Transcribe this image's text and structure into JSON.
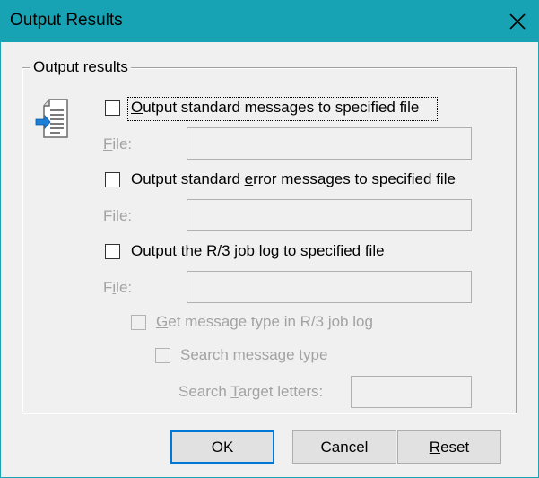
{
  "window": {
    "title": "Output Results",
    "close_icon": "close-icon"
  },
  "group": {
    "legend": "Output results",
    "icon": "document-output-icon"
  },
  "options": {
    "standard_messages": {
      "label_prefix": "",
      "label_mnemonic": "O",
      "label_rest": "utput standard messages to specified file",
      "checked": false,
      "file_label_mnemonic": "F",
      "file_label_rest": "ile:",
      "file_value": ""
    },
    "standard_error": {
      "label_prefix": "Output standard ",
      "label_mnemonic": "e",
      "label_rest": "rror messages to specified file",
      "checked": false,
      "file_label_prefix": "Fil",
      "file_label_mnemonic": "e",
      "file_label_rest": ":",
      "file_value": ""
    },
    "job_log": {
      "label": "Output the R/3 job log to specified file",
      "checked": false,
      "file_label_prefix": "F",
      "file_label_mnemonic": "i",
      "file_label_rest": "le:",
      "file_value": ""
    },
    "get_message_type": {
      "label_mnemonic": "G",
      "label_rest": "et message type in R/3 job log",
      "checked": false,
      "disabled": true
    },
    "search_message_type": {
      "label_mnemonic": "S",
      "label_rest": "earch message type",
      "checked": false,
      "disabled": true
    },
    "search_target": {
      "label_prefix": "Search ",
      "label_mnemonic": "T",
      "label_rest": "arget letters:",
      "value": ""
    }
  },
  "buttons": {
    "ok": "OK",
    "cancel": "Cancel",
    "reset_mnemonic": "R",
    "reset_rest": "eset"
  },
  "colors": {
    "titlebar": "#17a3b4",
    "default_button_border": "#0078d7"
  }
}
